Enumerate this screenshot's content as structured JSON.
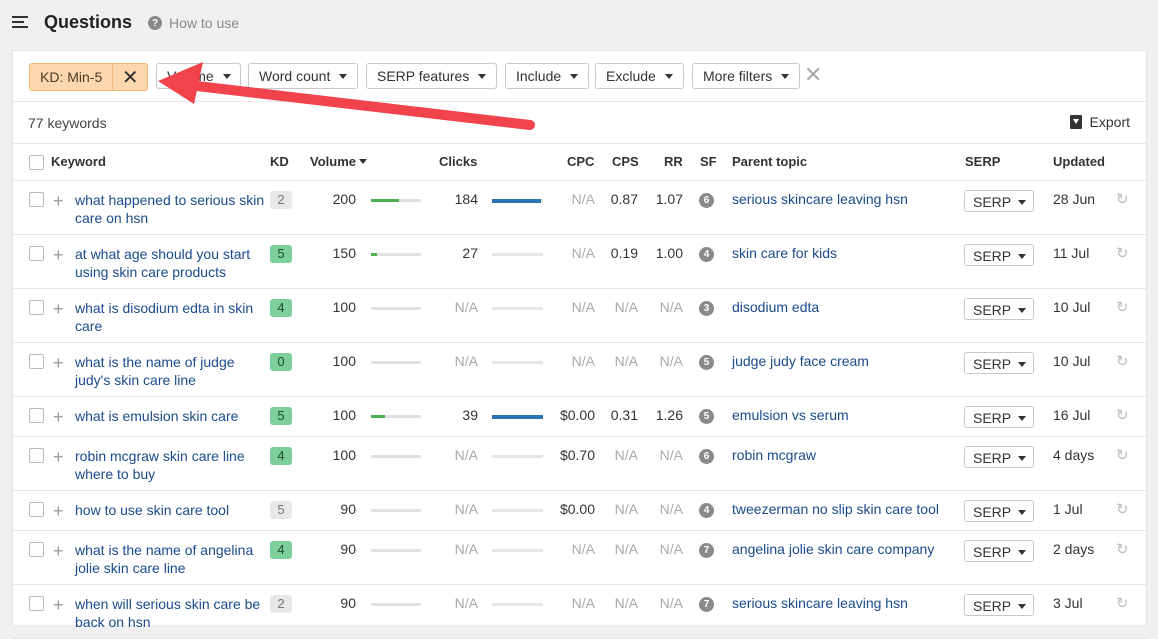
{
  "header": {
    "title": "Questions",
    "help_label": "How to use"
  },
  "filters": {
    "kd_chip_label": "KD: Min-5",
    "volume_label": "Volume",
    "word_count_label": "Word count",
    "serp_features_label": "SERP features",
    "include_label": "Include",
    "exclude_label": "Exclude",
    "more_filters_label": "More filters"
  },
  "summary": {
    "keyword_count": "77 keywords",
    "export_label": "Export"
  },
  "columns": {
    "keyword": "Keyword",
    "kd": "KD",
    "volume": "Volume",
    "clicks": "Clicks",
    "cpc": "CPC",
    "cps": "CPS",
    "rr": "RR",
    "sf": "SF",
    "parent_topic": "Parent topic",
    "serp": "SERP",
    "updated": "Updated"
  },
  "rows": [
    {
      "keyword": "what happened to serious skin care on hsn",
      "kd": "2",
      "kd_color": "#e8e8e8",
      "volume": "200",
      "volume_fraction": 0.55,
      "clicks": "184",
      "clicks_fraction": 0.96,
      "cpc": "N/A",
      "cps": "0.87",
      "rr": "1.07",
      "sf": "6",
      "parent_topic": "serious skincare leaving hsn",
      "serp": "SERP",
      "updated": "28 Jun"
    },
    {
      "keyword": "at what age should you start using skin care products",
      "kd": "5",
      "kd_color": "#7dcf9b",
      "volume": "150",
      "volume_fraction": 0.12,
      "clicks": "27",
      "clicks_fraction": 0,
      "cpc": "N/A",
      "cps": "0.19",
      "rr": "1.00",
      "sf": "4",
      "parent_topic": "skin care for kids",
      "serp": "SERP",
      "updated": "11 Jul"
    },
    {
      "keyword": "what is disodium edta in skin care",
      "kd": "4",
      "kd_color": "#7dcf9b",
      "volume": "100",
      "volume_fraction": 0,
      "clicks": "N/A",
      "clicks_fraction": 0,
      "cpc": "N/A",
      "cps": "N/A",
      "rr": "N/A",
      "sf": "3",
      "parent_topic": "disodium edta",
      "serp": "SERP",
      "updated": "10 Jul"
    },
    {
      "keyword": "what is the name of judge judy's skin care line",
      "kd": "0",
      "kd_color": "#7dcf9b",
      "volume": "100",
      "volume_fraction": 0,
      "clicks": "N/A",
      "clicks_fraction": 0,
      "cpc": "N/A",
      "cps": "N/A",
      "rr": "N/A",
      "sf": "5",
      "parent_topic": "judge judy face cream",
      "serp": "SERP",
      "updated": "10 Jul"
    },
    {
      "keyword": "what is emulsion skin care",
      "kd": "5",
      "kd_color": "#7dcf9b",
      "volume": "100",
      "volume_fraction": 0.28,
      "clicks": "39",
      "clicks_fraction": 1.0,
      "cpc": "$0.00",
      "cps": "0.31",
      "rr": "1.26",
      "sf": "5",
      "parent_topic": "emulsion vs serum",
      "serp": "SERP",
      "updated": "16 Jul"
    },
    {
      "keyword": "robin mcgraw skin care line where to buy",
      "kd": "4",
      "kd_color": "#7dcf9b",
      "volume": "100",
      "volume_fraction": 0,
      "clicks": "N/A",
      "clicks_fraction": 0,
      "cpc": "$0.70",
      "cps": "N/A",
      "rr": "N/A",
      "sf": "6",
      "parent_topic": "robin mcgraw",
      "serp": "SERP",
      "updated": "4 days"
    },
    {
      "keyword": "how to use skin care tool",
      "kd": "5",
      "kd_color": "#e8e8e8",
      "volume": "90",
      "volume_fraction": 0,
      "clicks": "N/A",
      "clicks_fraction": 0,
      "cpc": "$0.00",
      "cps": "N/A",
      "rr": "N/A",
      "sf": "4",
      "parent_topic": "tweezerman no slip skin care tool",
      "serp": "SERP",
      "updated": "1 Jul"
    },
    {
      "keyword": "what is the name of angelina jolie skin care line",
      "kd": "4",
      "kd_color": "#7dcf9b",
      "volume": "90",
      "volume_fraction": 0,
      "clicks": "N/A",
      "clicks_fraction": 0,
      "cpc": "N/A",
      "cps": "N/A",
      "rr": "N/A",
      "sf": "7",
      "parent_topic": "angelina jolie skin care company",
      "serp": "SERP",
      "updated": "2 days"
    },
    {
      "keyword": "when will serious skin care be back on hsn",
      "kd": "2",
      "kd_color": "#e8e8e8",
      "volume": "90",
      "volume_fraction": 0,
      "clicks": "N/A",
      "clicks_fraction": 0,
      "cpc": "N/A",
      "cps": "N/A",
      "rr": "N/A",
      "sf": "7",
      "parent_topic": "serious skincare leaving hsn",
      "serp": "SERP",
      "updated": "3 Jul"
    }
  ],
  "colors": {
    "arrow": "#f0434b",
    "link": "#1a4b8c",
    "chip": "#fdd8ae",
    "volume_bar": "#4caf50",
    "clicks_bar": "#2a74b5"
  }
}
